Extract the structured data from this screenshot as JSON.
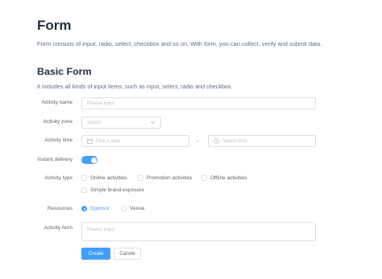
{
  "header": {
    "title": "Form",
    "description": "Form consists of input, radio, select, checkbox and so on. With form, you can collect, verify and submit data."
  },
  "section": {
    "title": "Basic Form",
    "description": "It includes all kinds of input items, such as input, select, radio and checkbox."
  },
  "form": {
    "activity_name": {
      "label": "Activity name",
      "value": "",
      "placeholder": "Please input"
    },
    "activity_zone": {
      "label": "Activity zone",
      "value": "",
      "placeholder": "Select"
    },
    "activity_time": {
      "label": "Activity time",
      "date_placeholder": "Pick a date",
      "separator": "-",
      "time_placeholder": "Select time"
    },
    "instant_delivery": {
      "label": "Instant delivery",
      "checked": true
    },
    "activity_type": {
      "label": "Activity type",
      "options": [
        {
          "label": "Online activities",
          "checked": false
        },
        {
          "label": "Promotion activities",
          "checked": false
        },
        {
          "label": "Offline activities",
          "checked": false
        },
        {
          "label": "Simple brand exposure",
          "checked": false
        }
      ]
    },
    "resources": {
      "label": "Resources",
      "options": [
        {
          "label": "Sponsor",
          "checked": true
        },
        {
          "label": "Venue",
          "checked": false
        }
      ]
    },
    "activity_form": {
      "label": "Activity form",
      "value": "",
      "placeholder": "Please input"
    },
    "buttons": {
      "create": "Create",
      "cancel": "Cancle"
    }
  },
  "colors": {
    "primary": "#409eff",
    "border": "#dcdfe6",
    "placeholder": "#c0c4cc",
    "text": "#606266"
  },
  "icons": {
    "date": "calendar-icon",
    "time": "clock-icon",
    "select": "chevron-down-icon"
  }
}
